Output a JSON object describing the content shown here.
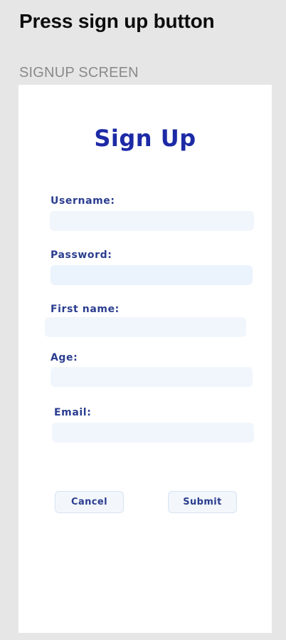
{
  "instruction": "Press sign up button",
  "screen_caption": "SIGNUP SCREEN",
  "form": {
    "title": "Sign Up",
    "fields": {
      "username": {
        "label": "Username:",
        "value": ""
      },
      "password": {
        "label": "Password:",
        "value": ""
      },
      "first_name": {
        "label": "First name:",
        "value": ""
      },
      "age": {
        "label": "Age:",
        "value": ""
      },
      "email": {
        "label": "Email:",
        "value": ""
      }
    },
    "buttons": {
      "cancel": "Cancel",
      "submit": "Submit"
    }
  },
  "colors": {
    "title": "#1d2aa6",
    "label": "#2a3d8f",
    "input_bg": "#f1f6fc",
    "page_bg": "#e6e6e6"
  }
}
